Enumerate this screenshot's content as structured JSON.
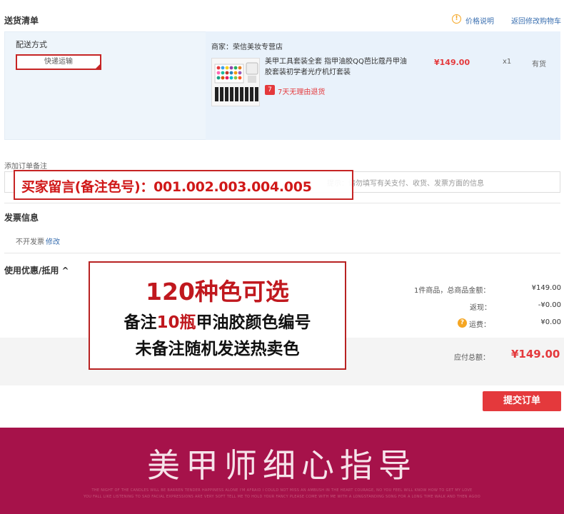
{
  "delivery": {
    "title": "送货清单",
    "price_note_link": "价格说明",
    "back_link": "返回修改购物车",
    "ship_method_label": "配送方式",
    "ship_method_value": "快递运输"
  },
  "product": {
    "shop": "商家：荣信美妆专营店",
    "title": "美甲工具套装全套 指甲油胶QQ芭比蔻丹甲油胶套装初学者光疗机灯套装",
    "price": "¥149.00",
    "qty": "x1",
    "stock": "有货",
    "return_badge": "7",
    "return_text": "7天无理由退货"
  },
  "order_note": {
    "label": "添加订单备注",
    "hint": "提示：请勿填写有关支付、收货、发票方面的信息",
    "overlay_text": "买家留言(备注色号)：001.002.003.004.005"
  },
  "invoice": {
    "title": "发票信息",
    "value": "不开发票",
    "edit_link": "修改"
  },
  "coupon": {
    "title": "使用优惠/抵用 ^"
  },
  "summary": {
    "items_label": "1件商品，总商品金额：",
    "items_value": "¥149.00",
    "rebate_label": "返现：",
    "rebate_value": "-¥0.00",
    "freight_label": "运费：",
    "freight_value": "¥0.00",
    "total_label": "应付总额：",
    "total_value": "¥149.00"
  },
  "promo": {
    "line1": "120种色可选",
    "line2_a": "备注",
    "line2_b": "10瓶",
    "line2_c": "甲油胶颜色编号",
    "line3": "未备注随机发送热卖色"
  },
  "submit_label": "提交订单",
  "banner": {
    "title": "美甲师细心指导",
    "small1": "THE NIGHT OF THE CANDLES WILL BE BARREN TENDER HAPPINESS ALONE I'M AFRAID I COULD NOT MISS AN AMBUSH IN THE HEART COURAGE, NO YOU FEEL WILL KNOW HOW TO GET MY LOVE",
    "small2": "YOU FALL LIKE LISTENING TO SAD FACIAL EXPRESSIONS ARE VERY SOFT TELL ME TO HOLD YOUR FANCY PLEASE COME WITH ME WITH A LONGSTANDING SONG FOR A LONG TIME WALK AND THEN AGOO"
  },
  "colors": {
    "accent_red": "#e4393c",
    "banner_bg": "#a6124a",
    "panel_bg": "#eef5fb"
  }
}
